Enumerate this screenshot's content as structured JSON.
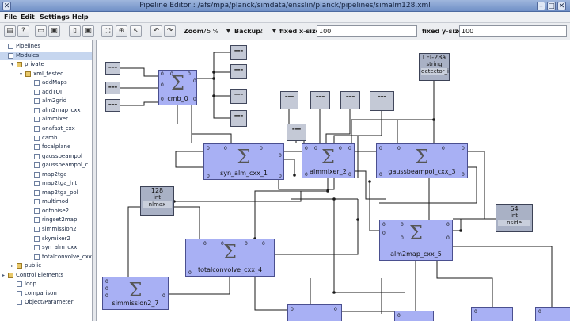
{
  "window": {
    "title": "Pipeline Editor : /afs/mpa/planck/simdata/ensslin/planck/pipelines/simalm128.xml"
  },
  "menu": {
    "items": [
      "File",
      "Edit",
      "Settings",
      "Help"
    ]
  },
  "toolbar": {
    "zoom_label": "Zoom",
    "zoom_value": "75 %",
    "backup_label": "Backup",
    "backup_value": "2",
    "xsize_label": "fixed x-size",
    "xsize_value": "100",
    "ysize_label": "fixed y-size",
    "ysize_value": "100"
  },
  "sidebar": {
    "tree": [
      {
        "label": "Pipelines",
        "level": 0,
        "kind": "file",
        "toggle": ""
      },
      {
        "label": "Modules",
        "level": 0,
        "kind": "file",
        "toggle": "",
        "selected": true
      },
      {
        "label": "private",
        "level": 1,
        "kind": "folder",
        "toggle": "▾"
      },
      {
        "label": "xml_tested",
        "level": 2,
        "kind": "folder",
        "toggle": "▾"
      },
      {
        "label": "addMaps",
        "level": 3,
        "kind": "file",
        "toggle": ""
      },
      {
        "label": "addTOI",
        "level": 3,
        "kind": "file",
        "toggle": ""
      },
      {
        "label": "alm2grid",
        "level": 3,
        "kind": "file",
        "toggle": ""
      },
      {
        "label": "alm2map_cxx",
        "level": 3,
        "kind": "file",
        "toggle": ""
      },
      {
        "label": "almmixer",
        "level": 3,
        "kind": "file",
        "toggle": ""
      },
      {
        "label": "anafast_cxx",
        "level": 3,
        "kind": "file",
        "toggle": ""
      },
      {
        "label": "camb",
        "level": 3,
        "kind": "file",
        "toggle": ""
      },
      {
        "label": "focalplane",
        "level": 3,
        "kind": "file",
        "toggle": ""
      },
      {
        "label": "gaussbeampol",
        "level": 3,
        "kind": "file",
        "toggle": ""
      },
      {
        "label": "gaussbeampol_c",
        "level": 3,
        "kind": "file",
        "toggle": ""
      },
      {
        "label": "map2tga",
        "level": 3,
        "kind": "file",
        "toggle": ""
      },
      {
        "label": "map2tga_hit",
        "level": 3,
        "kind": "file",
        "toggle": ""
      },
      {
        "label": "map2tga_pol",
        "level": 3,
        "kind": "file",
        "toggle": ""
      },
      {
        "label": "multimod",
        "level": 3,
        "kind": "file",
        "toggle": ""
      },
      {
        "label": "oofnoise2",
        "level": 3,
        "kind": "file",
        "toggle": ""
      },
      {
        "label": "ringset2map",
        "level": 3,
        "kind": "file",
        "toggle": ""
      },
      {
        "label": "simmission2",
        "level": 3,
        "kind": "file",
        "toggle": ""
      },
      {
        "label": "skymixer2",
        "level": 3,
        "kind": "file",
        "toggle": ""
      },
      {
        "label": "syn_alm_cxx",
        "level": 3,
        "kind": "file",
        "toggle": ""
      },
      {
        "label": "totalconvolve_cxx",
        "level": 3,
        "kind": "file",
        "toggle": ""
      },
      {
        "label": "public",
        "level": 1,
        "kind": "folder",
        "toggle": "▸"
      },
      {
        "label": "Control Elements",
        "level": 0,
        "kind": "folder",
        "toggle": "▸"
      },
      {
        "label": "loop",
        "level": 1,
        "kind": "file",
        "toggle": ""
      },
      {
        "label": "comparison",
        "level": 1,
        "kind": "file",
        "toggle": ""
      },
      {
        "label": "Object/Parameter",
        "level": 1,
        "kind": "file",
        "toggle": ""
      }
    ]
  },
  "canvas": {
    "modules": {
      "cmb": "cmb_0",
      "syn_alm": "syn_alm_cxx_1",
      "almmixer": "almmixer_2",
      "gaussbeampol": "gaussbeampol_cxx_3",
      "totalconvolve": "totalconvolve_cxx_4",
      "alm2map": "alm2map_cxx_5",
      "simmission": "simmission2_7"
    },
    "params": {
      "nlmax": {
        "value": "128",
        "type": "int",
        "name": "nlmax"
      },
      "detector": {
        "value": "LFI-28a",
        "type": "string",
        "name": "detector_id"
      },
      "nside": {
        "value": "64",
        "type": "int",
        "name": "nside"
      }
    },
    "colors": {
      "module_fill": "#a8b0f4",
      "param_fill": "#a9b1c5",
      "wire": "#1a1a1a",
      "canvas_bg": "#ffffff",
      "title_bar": "#7f9dd0"
    }
  }
}
